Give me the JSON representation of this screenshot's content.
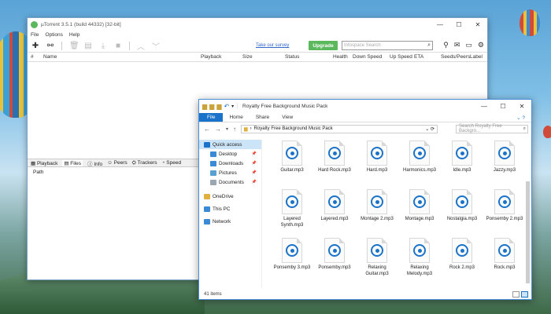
{
  "utorrent": {
    "title": "µTorrent 3.5.1  (build 44332) [32-bit]",
    "menu": [
      "File",
      "Options",
      "Help"
    ],
    "toolbar_icons": [
      "add-icon",
      "link-icon",
      "delete-icon",
      "file-icon",
      "download-icon",
      "stop-icon",
      "up-arrow-icon",
      "down-arrow-icon"
    ],
    "survey_link": "Take our survey",
    "upgrade_label": "Upgrade",
    "search_placeholder": "Infospace Search",
    "columns": [
      "#",
      "Name",
      "Playback",
      "Size",
      "Status",
      "Health",
      "Down Speed",
      "Up Speed",
      "ETA",
      "Seeds/Peers",
      "Label"
    ],
    "tabs": [
      "Playback",
      "Files",
      "Info",
      "Peers",
      "Trackers",
      "Speed"
    ],
    "active_tab": "Files",
    "files_header": "Path"
  },
  "explorer": {
    "title": "Royalty Free Background Music Pack",
    "ribbon": [
      "File",
      "Home",
      "Share",
      "View"
    ],
    "address": "Royalty Free Background Music Pack",
    "search_placeholder": "Search Royalty Free Backgro...",
    "nav": [
      {
        "label": "Quick access",
        "icon": "star-icon",
        "color": "#1a73c8",
        "sub": false,
        "sel": true
      },
      {
        "label": "Desktop",
        "icon": "desktop-icon",
        "color": "#3a8ad6",
        "sub": true,
        "pin": true
      },
      {
        "label": "Downloads",
        "icon": "downloads-icon",
        "color": "#3a8ad6",
        "sub": true,
        "pin": true
      },
      {
        "label": "Pictures",
        "icon": "pictures-icon",
        "color": "#5aa0d0",
        "sub": true,
        "pin": true
      },
      {
        "label": "Documents",
        "icon": "documents-icon",
        "color": "#9aa6b2",
        "sub": true,
        "pin": true
      },
      {
        "label": "OneDrive",
        "icon": "onedrive-icon",
        "color": "#e0b040",
        "sub": false
      },
      {
        "label": "This PC",
        "icon": "this-pc-icon",
        "color": "#3a8ad6",
        "sub": false
      },
      {
        "label": "Network",
        "icon": "network-icon",
        "color": "#3a8ad6",
        "sub": false
      }
    ],
    "files": [
      "Guitar.mp3",
      "Hard Rock.mp3",
      "Hard.mp3",
      "Harmonics.mp3",
      "Idle.mp3",
      "Jazzy.mp3",
      "Layered Synth.mp3",
      "Layered.mp3",
      "Montage 2.mp3",
      "Montage.mp3",
      "Nostalgia.mp3",
      "Ponsemby 2.mp3",
      "Ponsemby 3.mp3",
      "Ponsemby.mp3",
      "Relaxing Guitar.mp3",
      "Relaxing Melody.mp3",
      "Rock 2.mp3",
      "Rock.mp3"
    ],
    "status": "41 items",
    "accent": "#1a73c8"
  }
}
